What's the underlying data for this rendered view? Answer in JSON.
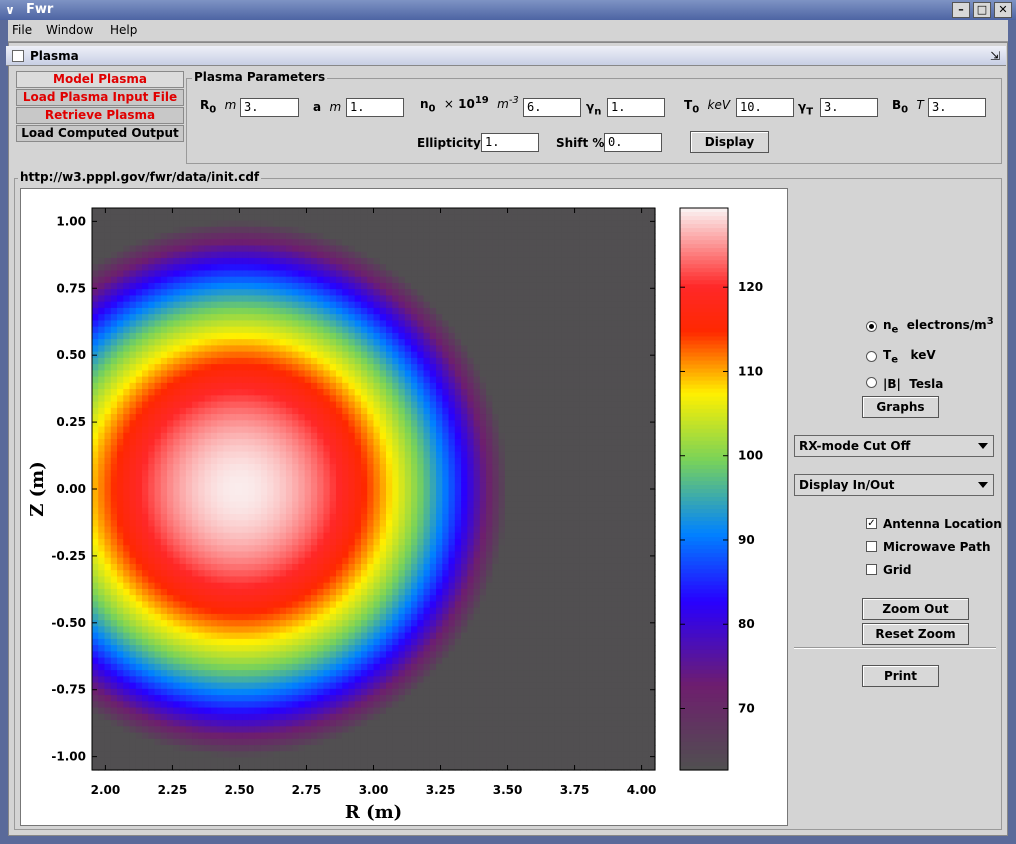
{
  "window": {
    "title": "Fwr",
    "menu": [
      "File",
      "Window",
      "Help"
    ]
  },
  "internal_frame": {
    "title": "Plasma"
  },
  "tabs": [
    {
      "label": "Model Plasma",
      "style": "red"
    },
    {
      "label": "Load Plasma Input File",
      "style": "red"
    },
    {
      "label": "Retrieve Plasma",
      "style": "red"
    },
    {
      "label": "Load Computed Output",
      "style": "black"
    }
  ],
  "params": {
    "legend": "Plasma Parameters",
    "R0": {
      "value": "3."
    },
    "a": {
      "value": "1."
    },
    "n0": {
      "value": "6."
    },
    "gamma_n": {
      "value": "1."
    },
    "T0": {
      "value": "10."
    },
    "gamma_T": {
      "value": "3."
    },
    "B0": {
      "value": "3."
    },
    "ellipticity": {
      "label": "Ellipticity",
      "value": "1."
    },
    "shift": {
      "label": "Shift %",
      "value": "0."
    },
    "display_button": "Display"
  },
  "url": "http://w3.pppl.gov/fwr/data/init.cdf",
  "controls": {
    "radios": [
      {
        "main": "n",
        "sub": "e",
        "unit": "electrons/m",
        "sup": "3",
        "selected": true
      },
      {
        "main": "T",
        "sub": "e",
        "unit": "keV",
        "sup": "",
        "selected": false
      },
      {
        "main": "|B|",
        "sub": "",
        "unit": "Tesla",
        "sup": "",
        "selected": false
      }
    ],
    "graphs_button": "Graphs",
    "cutoff_select": "RX-mode Cut Off",
    "display_select": "Display In/Out",
    "checks": [
      {
        "label": "Antenna Location",
        "checked": true
      },
      {
        "label": "Microwave Path",
        "checked": false
      },
      {
        "label": "Grid",
        "checked": false
      }
    ],
    "zoom_out": "Zoom Out",
    "reset_zoom": "Reset Zoom",
    "print": "Print"
  },
  "chart_data": {
    "type": "heatmap",
    "xlabel": "R (m)",
    "ylabel": "Z (m)",
    "xlim": [
      1.95,
      4.05
    ],
    "ylim": [
      -1.05,
      1.05
    ],
    "xticks": [
      "2.00",
      "2.25",
      "2.50",
      "2.75",
      "3.00",
      "3.25",
      "3.50",
      "3.75",
      "4.00"
    ],
    "yticks": [
      "1.00",
      "0.75",
      "0.50",
      "0.25",
      "0.00",
      "-0.25",
      "-0.50",
      "-0.75",
      "-1.00"
    ],
    "colorbar_ticks": [
      "120",
      "110",
      "100",
      "90",
      "80",
      "70"
    ],
    "colorbar_range": [
      62.7,
      129.4
    ],
    "center": {
      "R": 2.5,
      "Z": 0.0
    },
    "minor_radius": 1.0,
    "peak_value": 129,
    "edge_value": 63
  }
}
